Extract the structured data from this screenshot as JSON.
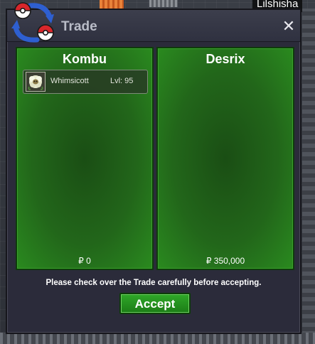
{
  "world": {
    "player_name_tag": "Lilshisha"
  },
  "window": {
    "title": "Trade",
    "close_label": "✕"
  },
  "panels": {
    "left": {
      "name": "Kombu",
      "money": "₽ 0",
      "pokemon": {
        "name": "Whimsicott",
        "level": "Lvl: 95"
      }
    },
    "right": {
      "name": "Desrix",
      "money": "₽ 350,000"
    }
  },
  "footer": {
    "notice": "Please check over the Trade carefully before accepting.",
    "accept_label": "Accept"
  },
  "colors": {
    "panel_green": "#22661a",
    "accept_green": "#2fa728",
    "window_bg": "#2b2b3a"
  }
}
